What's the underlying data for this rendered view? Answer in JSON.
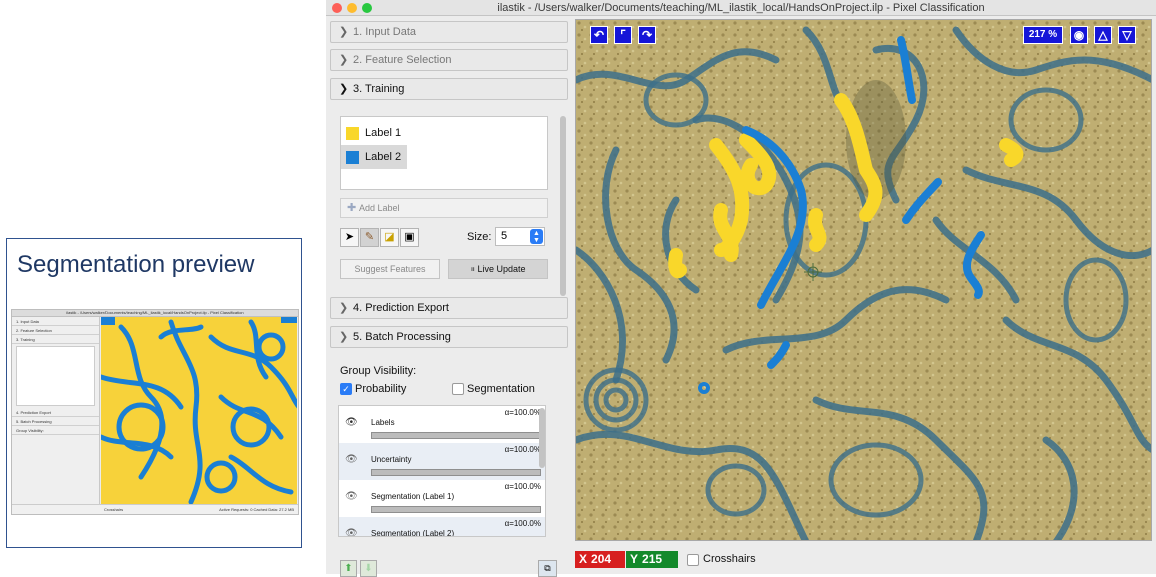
{
  "slide": {
    "title": "Segmentation preview"
  },
  "window": {
    "title": "ilastik - /Users/walker/Documents/teaching/ML_ilastik_local/HandsOnProject.ilp - Pixel Classification"
  },
  "applets": [
    {
      "label": "1. Input Data",
      "expanded": false
    },
    {
      "label": "2. Feature Selection",
      "expanded": false
    },
    {
      "label": "3. Training",
      "expanded": true
    },
    {
      "label": "4. Prediction Export",
      "expanded": false
    },
    {
      "label": "5. Batch Processing",
      "expanded": false
    }
  ],
  "training": {
    "labels": [
      {
        "name": "Label 1",
        "color": "#f9d72a"
      },
      {
        "name": "Label 2",
        "color": "#1a7fd4"
      }
    ],
    "add_label": "Add Label",
    "size_label": "Size:",
    "size_value": "5",
    "suggest_features": "Suggest Features",
    "live_update": "Live Update"
  },
  "visibility": {
    "title": "Group Visibility:",
    "probability": "Probability",
    "probability_checked": true,
    "segmentation": "Segmentation",
    "segmentation_checked": false,
    "layers": [
      {
        "name": "Labels",
        "alpha": "α=100.0%"
      },
      {
        "name": "Uncertainty",
        "alpha": "α=100.0%"
      },
      {
        "name": "Segmentation (Label 1)",
        "alpha": "α=100.0%"
      },
      {
        "name": "Segmentation (Label 2)",
        "alpha": "α=100.0%"
      }
    ]
  },
  "viewer": {
    "zoom": "217 %"
  },
  "status": {
    "x_key": "X",
    "x_value": "204",
    "y_key": "Y",
    "y_value": "215",
    "crosshairs": "Crosshairs"
  },
  "mini": {
    "title": "ilastik - /Users/walker/Documents/teaching/ML_ilastik_local/HandsOnProject.ilp - Pixel Classification",
    "applets": [
      "1. Input Data",
      "2. Feature Selection",
      "3. Training",
      "",
      "",
      "",
      "",
      "4. Prediction Export",
      "5. Batch Processing",
      "Group Visibility:"
    ],
    "status": "Active Requests: 0  Cached Data: 27.2 MB",
    "crosshairs": "Crosshairs"
  }
}
